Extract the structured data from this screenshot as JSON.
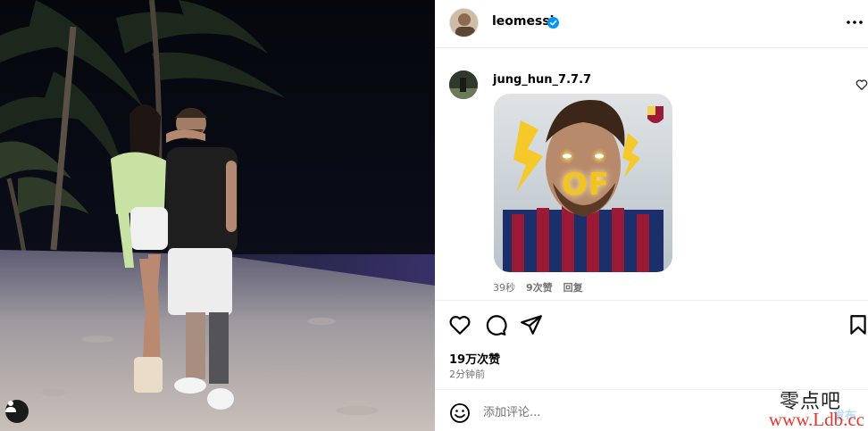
{
  "post": {
    "author_username": "leomessi",
    "verified_icon": "verified-badge-icon",
    "more_icon": "more-options-icon"
  },
  "photo": {
    "description_icon": "user-tag-icon"
  },
  "comment": {
    "username": "jung_hun_7.7.7",
    "sticker_text": "OF",
    "time": "39秒",
    "likes": "9次赞",
    "reply_label": "回复"
  },
  "actions": {
    "like_icon": "heart-icon",
    "comment_icon": "comment-icon",
    "share_icon": "share-icon",
    "save_icon": "bookmark-icon"
  },
  "likes_text": "19万次赞",
  "post_time": "2分钟前",
  "comment_box": {
    "placeholder": "添加评论...",
    "post_label": "发布"
  },
  "watermark": {
    "line1": "零点吧",
    "line2": "www.Ldb.cc"
  },
  "colors": {
    "verified": "#0095f6",
    "muted_text": "#737373",
    "watermark_red": "#e8372b"
  }
}
